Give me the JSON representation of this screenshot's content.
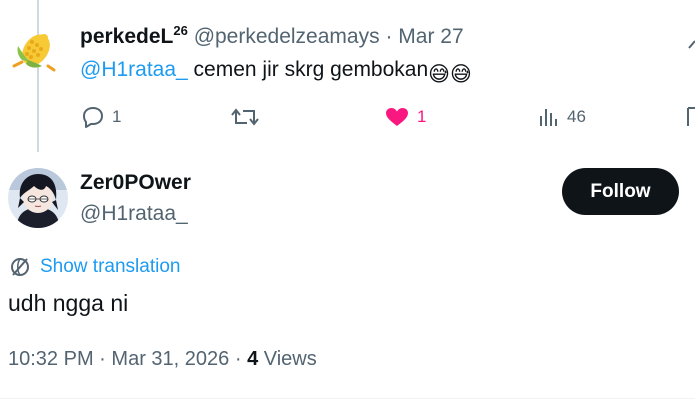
{
  "reply": {
    "display_name": "perkedeL",
    "name_superscript": "26",
    "handle": "@perkedelzeamays",
    "separator": "·",
    "date": "Mar 27",
    "mention": "@H1rataa_",
    "text": " cemen jir skrg gembokan",
    "emojis": "😅😅",
    "avatar_icon": "corn-cartoon-avatar",
    "actions": {
      "reply_count": "1",
      "like_count": "1",
      "views_count": "46"
    },
    "like_color": "#f91880"
  },
  "tweet": {
    "display_name": "Zer0POwer",
    "handle": "@H1rataa_",
    "follow_label": "Follow",
    "translate_label": "Show translation",
    "text": "udh ngga ni",
    "time": "10:32 PM",
    "separator": "·",
    "date": "Mar 31, 2026",
    "views_count": "4",
    "views_label": "Views",
    "avatar_icon": "anime-character-avatar"
  },
  "colors": {
    "link": "#1d9bf0",
    "secondary_text": "#536471",
    "primary_text": "#0f1419",
    "like": "#f91880",
    "follow_bg": "#0f1419"
  }
}
